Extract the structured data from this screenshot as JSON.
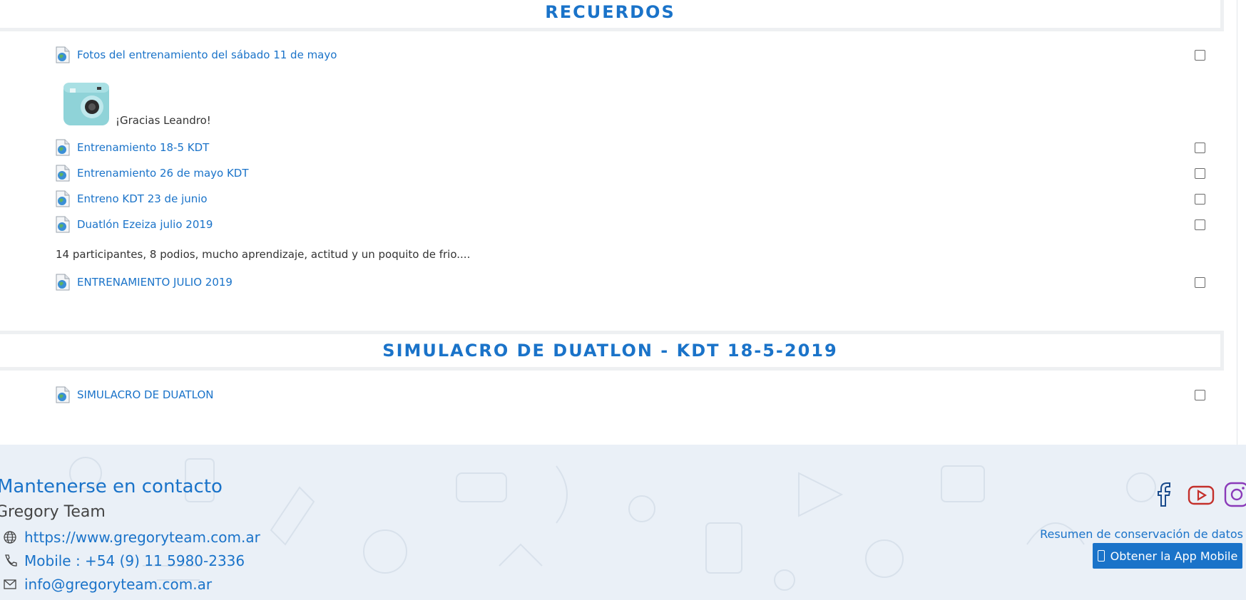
{
  "sections": [
    {
      "title": "RECUERDOS",
      "activities": [
        {
          "label": "Fotos del entrenamiento del sábado 11 de mayo"
        },
        {
          "label": "Entrenamiento 18-5 KDT"
        },
        {
          "label": "Entrenamiento 26 de mayo KDT"
        },
        {
          "label": "Entreno KDT 23 de junio"
        },
        {
          "label": "Duatlón Ezeiza julio 2019"
        },
        {
          "label": "ENTRENAMIENTO JULIO 2019"
        }
      ],
      "labels": {
        "gracias": "¡Gracias Leandro!",
        "participantes": "14 participantes, 8 podios, mucho aprendizaje, actitud y un poquito de frio...."
      }
    },
    {
      "title": "SIMULACRO DE DUATLON - KDT 18-5-2019",
      "activities": [
        {
          "label": "SIMULACRO DE DUATLON"
        }
      ]
    }
  ],
  "footer": {
    "contact_title": "Mantenerse en contacto",
    "org_name": "Gregory Team",
    "website": "https://www.gregoryteam.com.ar",
    "phone": "Mobile : +54 (9) 11 5980-2336",
    "email": "info@gregoryteam.com.ar",
    "retention_link": "Resumen de conservación de datos",
    "app_button": "Obtener la App Mobile",
    "social_icons": [
      "facebook-icon",
      "youtube-icon",
      "instagram-icon"
    ]
  },
  "colors": {
    "accent": "#1a73c9",
    "facebook": "#1a4b8c",
    "youtube": "#c4302b",
    "instagram": "#8a3ab9"
  }
}
